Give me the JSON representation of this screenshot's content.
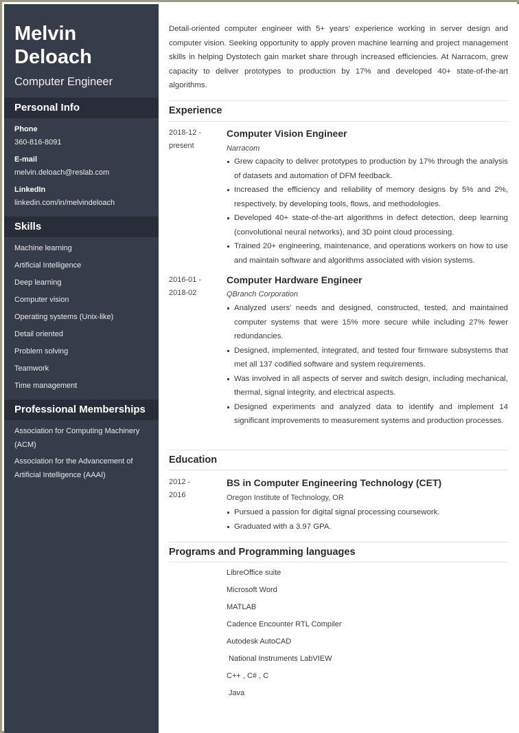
{
  "sidebar": {
    "name": "Melvin Deloach",
    "job_title": "Computer Engineer",
    "personal_info": {
      "heading": "Personal Info",
      "fields": [
        {
          "label": "Phone",
          "value": "360-816-8091"
        },
        {
          "label": "E-mail",
          "value": "melvin.deloach@reslab.com"
        },
        {
          "label": "LinkedIn",
          "value": "linkedin.com/in/melvindeloach"
        }
      ]
    },
    "skills": {
      "heading": "Skills",
      "items": [
        "Machine learning",
        "Artificial Intelligence",
        "Deep learning",
        "Computer vision",
        "Operating systems (Unix-like)",
        "Detail oriented",
        "Problem solving",
        "Teamwork",
        "Time management"
      ]
    },
    "memberships": {
      "heading": "Professional Memberships",
      "items": [
        "Association for Computing Machinery (ACM)",
        "Association for the Advancement of Artificial Intelligence (AAAI)"
      ]
    }
  },
  "main": {
    "summary": "Detail-oriented computer engineer with 5+ years' experience working in server design and computer vision. Seeking opportunity to apply proven machine learning and project management skills in helping Dystotech gain market share through increased efficiencies. At Narracom, grew capacity to deliver prototypes to production by 17% and developed 40+ state-of-the-art algorithms.",
    "experience": {
      "heading": "Experience",
      "jobs": [
        {
          "date_start": "2018-12 -",
          "date_end": "present",
          "title": "Computer Vision Engineer",
          "company": "Narracom",
          "bullets": [
            "Grew capacity to deliver prototypes to production by 17% through the analysis of datasets and automation of DFM feedback.",
            "Increased the efficiency and reliability of memory designs by 5% and 2%, respectively, by developing tools, flows, and methodologies.",
            "Developed 40+ state-of-the-art algorithms in defect detection, deep learning (convolutional neural networks), and 3D point cloud processing.",
            "Trained 20+ engineering, maintenance, and operations workers on how to use and maintain software and algorithms associated with vision systems."
          ]
        },
        {
          "date_start": "2016-01 -",
          "date_end": "2018-02",
          "title": "Computer Hardware Engineer",
          "company": "QBranch Corporation",
          "bullets": [
            "Analyzed users' needs and designed, constructed, tested, and maintained computer systems that were 15% more secure while including 27% fewer redundancies.",
            "Designed, implemented, integrated, and tested four firmware subsystems that met all 137 codified software and system requirements.",
            "Was involved in all aspects of server and switch design, including mechanical, thermal, signal integrity, and electrical aspects.",
            "Designed experiments and analyzed data to identify and implement 14 significant improvements to measurement systems and production processes."
          ]
        }
      ]
    },
    "education": {
      "heading": "Education",
      "entries": [
        {
          "date_start": "2012 -",
          "date_end": "2016",
          "degree": "BS in Computer Engineering Technology (CET)",
          "school": "Oregon Institute of Technology, OR",
          "bullets": [
            "Pursued a passion for digital signal processing coursework.",
            "Graduated with a 3.97 GPA."
          ]
        }
      ]
    },
    "programs": {
      "heading": "Programs and Programming languages",
      "items": [
        "LibreOffice suite",
        "Microsoft Word",
        "MATLAB",
        "Cadence Encounter RTL Compiler",
        "Autodesk AutoCAD",
        " National Instruments LabVIEW",
        "C++ , C# , C",
        " Java"
      ]
    }
  }
}
